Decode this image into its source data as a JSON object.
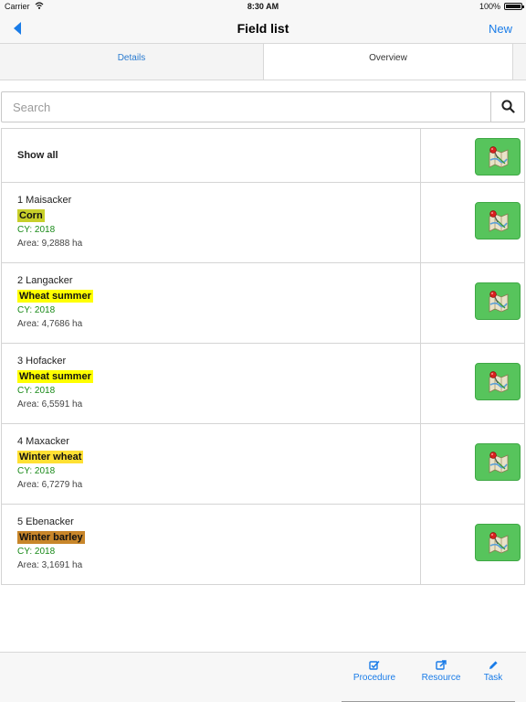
{
  "status_bar": {
    "carrier": "Carrier",
    "time": "8:30 AM",
    "battery": "100%"
  },
  "nav": {
    "title": "Field list",
    "new_label": "New"
  },
  "tabs": [
    {
      "label": "Details",
      "selected": false
    },
    {
      "label": "Overview",
      "selected": true
    }
  ],
  "search": {
    "placeholder": "Search",
    "value": ""
  },
  "show_all_label": "Show all",
  "fields": [
    {
      "name": "1 Maisacker",
      "crop": "Corn",
      "crop_color": "#c8cf2a",
      "cy": "CY: 2018",
      "area": "Area: 9,2888 ha"
    },
    {
      "name": "2 Langacker",
      "crop": "Wheat summer",
      "crop_color": "#ffff00",
      "cy": "CY: 2018",
      "area": "Area: 4,7686 ha"
    },
    {
      "name": "3 Hofacker",
      "crop": "Wheat summer",
      "crop_color": "#ffff00",
      "cy": "CY: 2018",
      "area": "Area: 6,5591 ha"
    },
    {
      "name": "4 Maxacker",
      "crop": "Winter wheat",
      "crop_color": "#ffe033",
      "cy": "CY: 2018",
      "area": "Area: 6,7279 ha"
    },
    {
      "name": "5 Ebenacker",
      "crop": "Winter barley",
      "crop_color": "#c8862a",
      "cy": "CY: 2018",
      "area": "Area: 3,1691 ha"
    }
  ],
  "toolbar": {
    "procedure_label": "Procedure",
    "resource_label": "Resource",
    "task_label": "Task"
  },
  "colors": {
    "accent": "#1a7ce8",
    "map_button": "#57c45c",
    "crop_year": "#1a8a1a"
  },
  "icons": {
    "back": "chevron-left-icon",
    "search": "search-icon",
    "map": "map-pin-icon",
    "procedure": "checkbox-edit-icon",
    "resource": "external-edit-icon",
    "task": "pencil-icon"
  }
}
